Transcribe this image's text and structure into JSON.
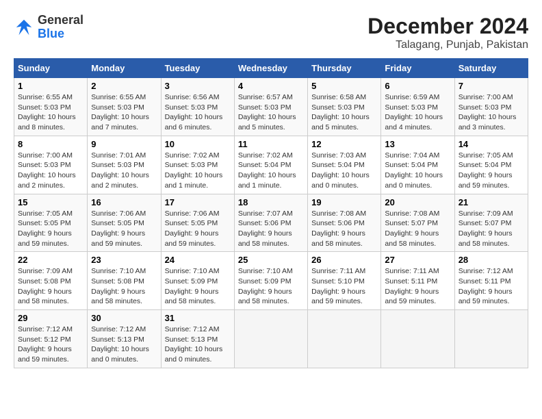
{
  "logo": {
    "line1": "General",
    "line2": "Blue"
  },
  "title": "December 2024",
  "subtitle": "Talagang, Punjab, Pakistan",
  "calendar": {
    "headers": [
      "Sunday",
      "Monday",
      "Tuesday",
      "Wednesday",
      "Thursday",
      "Friday",
      "Saturday"
    ],
    "weeks": [
      [
        {
          "day": "",
          "info": ""
        },
        {
          "day": "2",
          "info": "Sunrise: 6:55 AM\nSunset: 5:03 PM\nDaylight: 10 hours\nand 7 minutes."
        },
        {
          "day": "3",
          "info": "Sunrise: 6:56 AM\nSunset: 5:03 PM\nDaylight: 10 hours\nand 6 minutes."
        },
        {
          "day": "4",
          "info": "Sunrise: 6:57 AM\nSunset: 5:03 PM\nDaylight: 10 hours\nand 5 minutes."
        },
        {
          "day": "5",
          "info": "Sunrise: 6:58 AM\nSunset: 5:03 PM\nDaylight: 10 hours\nand 5 minutes."
        },
        {
          "day": "6",
          "info": "Sunrise: 6:59 AM\nSunset: 5:03 PM\nDaylight: 10 hours\nand 4 minutes."
        },
        {
          "day": "7",
          "info": "Sunrise: 7:00 AM\nSunset: 5:03 PM\nDaylight: 10 hours\nand 3 minutes."
        }
      ],
      [
        {
          "day": "1",
          "info": "Sunrise: 6:55 AM\nSunset: 5:03 PM\nDaylight: 10 hours\nand 8 minutes."
        },
        {
          "day": "9",
          "info": "Sunrise: 7:01 AM\nSunset: 5:03 PM\nDaylight: 10 hours\nand 2 minutes."
        },
        {
          "day": "10",
          "info": "Sunrise: 7:02 AM\nSunset: 5:03 PM\nDaylight: 10 hours\nand 1 minute."
        },
        {
          "day": "11",
          "info": "Sunrise: 7:02 AM\nSunset: 5:04 PM\nDaylight: 10 hours\nand 1 minute."
        },
        {
          "day": "12",
          "info": "Sunrise: 7:03 AM\nSunset: 5:04 PM\nDaylight: 10 hours\nand 0 minutes."
        },
        {
          "day": "13",
          "info": "Sunrise: 7:04 AM\nSunset: 5:04 PM\nDaylight: 10 hours\nand 0 minutes."
        },
        {
          "day": "14",
          "info": "Sunrise: 7:05 AM\nSunset: 5:04 PM\nDaylight: 9 hours\nand 59 minutes."
        }
      ],
      [
        {
          "day": "8",
          "info": "Sunrise: 7:00 AM\nSunset: 5:03 PM\nDaylight: 10 hours\nand 2 minutes."
        },
        {
          "day": "16",
          "info": "Sunrise: 7:06 AM\nSunset: 5:05 PM\nDaylight: 9 hours\nand 59 minutes."
        },
        {
          "day": "17",
          "info": "Sunrise: 7:06 AM\nSunset: 5:05 PM\nDaylight: 9 hours\nand 59 minutes."
        },
        {
          "day": "18",
          "info": "Sunrise: 7:07 AM\nSunset: 5:06 PM\nDaylight: 9 hours\nand 58 minutes."
        },
        {
          "day": "19",
          "info": "Sunrise: 7:08 AM\nSunset: 5:06 PM\nDaylight: 9 hours\nand 58 minutes."
        },
        {
          "day": "20",
          "info": "Sunrise: 7:08 AM\nSunset: 5:07 PM\nDaylight: 9 hours\nand 58 minutes."
        },
        {
          "day": "21",
          "info": "Sunrise: 7:09 AM\nSunset: 5:07 PM\nDaylight: 9 hours\nand 58 minutes."
        }
      ],
      [
        {
          "day": "15",
          "info": "Sunrise: 7:05 AM\nSunset: 5:05 PM\nDaylight: 9 hours\nand 59 minutes."
        },
        {
          "day": "23",
          "info": "Sunrise: 7:10 AM\nSunset: 5:08 PM\nDaylight: 9 hours\nand 58 minutes."
        },
        {
          "day": "24",
          "info": "Sunrise: 7:10 AM\nSunset: 5:09 PM\nDaylight: 9 hours\nand 58 minutes."
        },
        {
          "day": "25",
          "info": "Sunrise: 7:10 AM\nSunset: 5:09 PM\nDaylight: 9 hours\nand 58 minutes."
        },
        {
          "day": "26",
          "info": "Sunrise: 7:11 AM\nSunset: 5:10 PM\nDaylight: 9 hours\nand 59 minutes."
        },
        {
          "day": "27",
          "info": "Sunrise: 7:11 AM\nSunset: 5:11 PM\nDaylight: 9 hours\nand 59 minutes."
        },
        {
          "day": "28",
          "info": "Sunrise: 7:12 AM\nSunset: 5:11 PM\nDaylight: 9 hours\nand 59 minutes."
        }
      ],
      [
        {
          "day": "22",
          "info": "Sunrise: 7:09 AM\nSunset: 5:08 PM\nDaylight: 9 hours\nand 58 minutes."
        },
        {
          "day": "30",
          "info": "Sunrise: 7:12 AM\nSunset: 5:13 PM\nDaylight: 10 hours\nand 0 minutes."
        },
        {
          "day": "31",
          "info": "Sunrise: 7:12 AM\nSunset: 5:13 PM\nDaylight: 10 hours\nand 0 minutes."
        },
        {
          "day": "",
          "info": ""
        },
        {
          "day": "",
          "info": ""
        },
        {
          "day": "",
          "info": ""
        },
        {
          "day": ""
        }
      ],
      [
        {
          "day": "29",
          "info": "Sunrise: 7:12 AM\nSunset: 5:12 PM\nDaylight: 9 hours\nand 59 minutes."
        },
        {
          "day": "",
          "info": ""
        },
        {
          "day": "",
          "info": ""
        },
        {
          "day": "",
          "info": ""
        },
        {
          "day": "",
          "info": ""
        },
        {
          "day": "",
          "info": ""
        },
        {
          "day": "",
          "info": ""
        }
      ]
    ]
  }
}
